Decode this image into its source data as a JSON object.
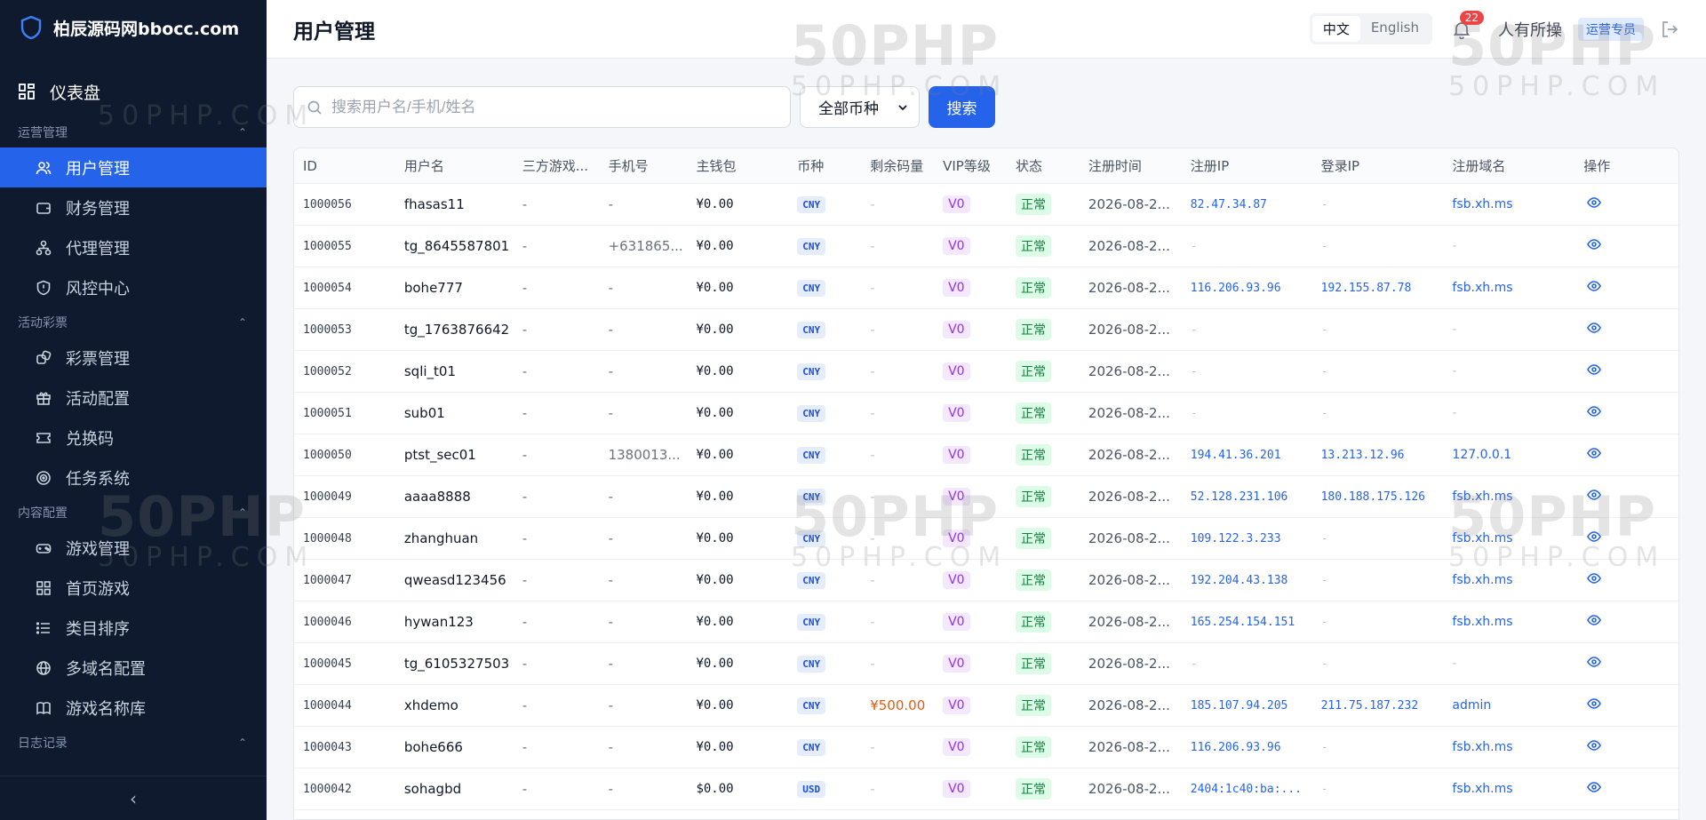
{
  "sidebar": {
    "brand": "柏辰源码网bbocc.com",
    "dashboard": "仪表盘",
    "sections": [
      {
        "title": "运营管理",
        "items": [
          "用户管理",
          "财务管理",
          "代理管理",
          "风控中心"
        ]
      },
      {
        "title": "活动彩票",
        "items": [
          "彩票管理",
          "活动配置",
          "兑换码",
          "任务系统"
        ]
      },
      {
        "title": "内容配置",
        "items": [
          "游戏管理",
          "首页游戏",
          "类目排序",
          "多域名配置",
          "游戏名称库"
        ]
      },
      {
        "title": "日志记录",
        "items": []
      }
    ],
    "active_item": "用户管理",
    "collapse_icon": "‹"
  },
  "header": {
    "title": "用户管理",
    "lang_options": [
      "中文",
      "English"
    ],
    "lang_selected": "中文",
    "notification_count": "22",
    "user_name": "人有所操",
    "user_role": "运营专员"
  },
  "filters": {
    "search_placeholder": "搜索用户名/手机/姓名",
    "currency_selected": "全部币种",
    "search_button": "搜索"
  },
  "table": {
    "columns": [
      "ID",
      "用户名",
      "三方游戏...",
      "手机号",
      "主钱包",
      "币种",
      "剩余码量",
      "VIP等级",
      "状态",
      "注册时间",
      "注册IP",
      "登录IP",
      "注册域名",
      "操作"
    ],
    "rows": [
      [
        "1000056",
        "fhasas11",
        "-",
        "-",
        "¥0.00",
        "CNY",
        "-",
        "V0",
        "正常",
        "2026-08-2...",
        "82.47.34.87",
        "-",
        "fsb.xh.ms"
      ],
      [
        "1000055",
        "tg_8645587801",
        "-",
        "+631865...",
        "¥0.00",
        "CNY",
        "-",
        "V0",
        "正常",
        "2026-08-2...",
        "-",
        "-",
        "-"
      ],
      [
        "1000054",
        "bohe777",
        "-",
        "-",
        "¥0.00",
        "CNY",
        "-",
        "V0",
        "正常",
        "2026-08-2...",
        "116.206.93.96",
        "192.155.87.78",
        "fsb.xh.ms"
      ],
      [
        "1000053",
        "tg_1763876642",
        "-",
        "-",
        "¥0.00",
        "CNY",
        "-",
        "V0",
        "正常",
        "2026-08-2...",
        "-",
        "-",
        "-"
      ],
      [
        "1000052",
        "sqli_t01",
        "-",
        "-",
        "¥0.00",
        "CNY",
        "-",
        "V0",
        "正常",
        "2026-08-2...",
        "-",
        "-",
        "-"
      ],
      [
        "1000051",
        "sub01",
        "-",
        "-",
        "¥0.00",
        "CNY",
        "-",
        "V0",
        "正常",
        "2026-08-2...",
        "-",
        "-",
        "-"
      ],
      [
        "1000050",
        "ptst_sec01",
        "-",
        "1380013...",
        "¥0.00",
        "CNY",
        "-",
        "V0",
        "正常",
        "2026-08-2...",
        "194.41.36.201",
        "13.213.12.96",
        "127.0.0.1"
      ],
      [
        "1000049",
        "aaaa8888",
        "-",
        "-",
        "¥0.00",
        "CNY",
        "-",
        "V0",
        "正常",
        "2026-08-2...",
        "52.128.231.106",
        "180.188.175.126",
        "fsb.xh.ms"
      ],
      [
        "1000048",
        "zhanghuan",
        "-",
        "-",
        "¥0.00",
        "CNY",
        "-",
        "V0",
        "正常",
        "2026-08-2...",
        "109.122.3.233",
        "-",
        "fsb.xh.ms"
      ],
      [
        "1000047",
        "qweasd123456",
        "-",
        "-",
        "¥0.00",
        "CNY",
        "-",
        "V0",
        "正常",
        "2026-08-2...",
        "192.204.43.138",
        "-",
        "fsb.xh.ms"
      ],
      [
        "1000046",
        "hywan123",
        "-",
        "-",
        "¥0.00",
        "CNY",
        "-",
        "V0",
        "正常",
        "2026-08-2...",
        "165.254.154.151",
        "-",
        "fsb.xh.ms"
      ],
      [
        "1000045",
        "tg_6105327503",
        "-",
        "-",
        "¥0.00",
        "CNY",
        "-",
        "V0",
        "正常",
        "2026-08-2...",
        "-",
        "-",
        "-"
      ],
      [
        "1000044",
        "xhdemo",
        "-",
        "-",
        "¥0.00",
        "CNY",
        "¥500.00",
        "V0",
        "正常",
        "2026-08-2...",
        "185.107.94.205",
        "211.75.187.232",
        "admin"
      ],
      [
        "1000043",
        "bohe666",
        "-",
        "-",
        "¥0.00",
        "CNY",
        "-",
        "V0",
        "正常",
        "2026-08-2...",
        "116.206.93.96",
        "-",
        "fsb.xh.ms"
      ],
      [
        "1000042",
        "sohagbd",
        "-",
        "-",
        "$0.00",
        "USD",
        "-",
        "V0",
        "正常",
        "2026-08-2...",
        "2404:1c40:ba:...",
        "-",
        "fsb.xh.ms"
      ]
    ]
  },
  "watermark": {
    "big": "50PHP",
    "small": "50PHP.COM"
  },
  "colors": {
    "sidebar_bg": "#0f1a2e",
    "accent": "#2563eb",
    "status_green": "#15803d",
    "vip_purple": "#9333ea"
  }
}
